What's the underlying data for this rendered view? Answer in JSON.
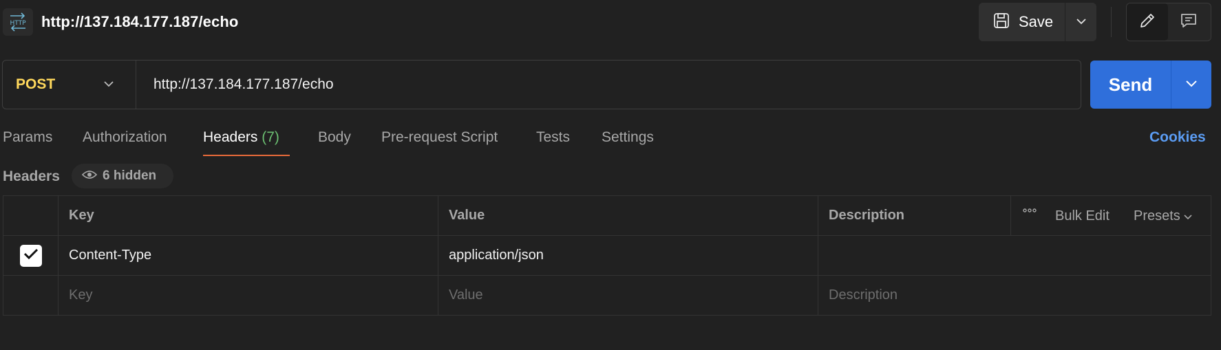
{
  "request": {
    "title": "http://137.184.177.187/echo",
    "method": "POST",
    "url": "http://137.184.177.187/echo"
  },
  "toolbar": {
    "save_label": "Save",
    "send_label": "Send"
  },
  "tabs": [
    {
      "label": "Params"
    },
    {
      "label": "Authorization"
    },
    {
      "label": "Headers",
      "count": "(7)"
    },
    {
      "label": "Body"
    },
    {
      "label": "Pre-request Script"
    },
    {
      "label": "Tests"
    },
    {
      "label": "Settings"
    }
  ],
  "active_tab": "Headers",
  "cookies_label": "Cookies",
  "headers_section": {
    "label": "Headers",
    "hidden_label": "6 hidden"
  },
  "table": {
    "columns": {
      "key": "Key",
      "value": "Value",
      "description": "Description"
    },
    "actions": {
      "bulk_edit": "Bulk Edit",
      "presets": "Presets"
    },
    "rows": [
      {
        "checked": true,
        "key": "Content-Type",
        "value": "application/json",
        "description": ""
      }
    ],
    "placeholders": {
      "key": "Key",
      "value": "Value",
      "description": "Description"
    }
  },
  "colors": {
    "method": "#ffd85c",
    "send": "#2f6fdb",
    "tab_underline": "#e96a3a",
    "count": "#6cc072",
    "cookies": "#5b9cf3"
  },
  "icons": [
    "http-icon",
    "save-icon",
    "chevron-down-icon",
    "pencil-icon",
    "comment-icon",
    "eye-icon",
    "more-icon",
    "checkmark-icon"
  ]
}
